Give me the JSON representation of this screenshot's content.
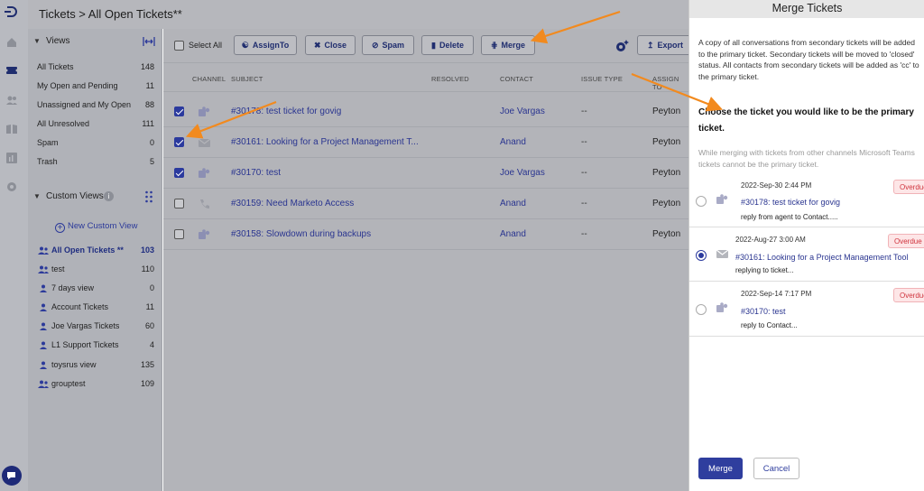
{
  "header": {
    "title": "Tickets > All Open Tickets**"
  },
  "rail": {
    "icons": [
      "logo-icon",
      "home-icon",
      "tickets-icon",
      "contacts-icon",
      "knowledge-base-icon",
      "reports-icon",
      "settings-icon",
      "chat-icon"
    ]
  },
  "views": {
    "title": "Views",
    "items": [
      {
        "label": "All Tickets",
        "count": "148"
      },
      {
        "label": "My Open and Pending",
        "count": "11"
      },
      {
        "label": "Unassigned and My Open",
        "count": "88"
      },
      {
        "label": "All Unresolved",
        "count": "111"
      },
      {
        "label": "Spam",
        "count": "0"
      },
      {
        "label": "Trash",
        "count": "5"
      }
    ]
  },
  "custom_views": {
    "title": "Custom Views",
    "new_label": "New Custom View",
    "items": [
      {
        "label": "All Open Tickets **",
        "count": "103",
        "icon": "group-icon",
        "active": true
      },
      {
        "label": "test",
        "count": "110",
        "icon": "group-icon"
      },
      {
        "label": "7 days view",
        "count": "0",
        "icon": "user-icon"
      },
      {
        "label": "Account Tickets",
        "count": "11",
        "icon": "user-icon"
      },
      {
        "label": "Joe Vargas Tickets",
        "count": "60",
        "icon": "user-icon"
      },
      {
        "label": "L1 Support Tickets",
        "count": "4",
        "icon": "user-icon"
      },
      {
        "label": "toysrus view",
        "count": "135",
        "icon": "user-icon"
      },
      {
        "label": "grouptest",
        "count": "109",
        "icon": "group-icon"
      }
    ]
  },
  "toolbar": {
    "select_all": "Select All",
    "assign": "AssignTo",
    "close": "Close",
    "spam": "Spam",
    "delete": "Delete",
    "merge": "Merge",
    "export": "Export"
  },
  "table": {
    "columns": [
      "CHANNEL",
      "SUBJECT",
      "RESOLVED",
      "CONTACT",
      "ISSUE TYPE",
      "ASSIGN TO"
    ],
    "rows": [
      {
        "checked": true,
        "channel": "teams",
        "subject": "#30178: test ticket for govig",
        "contact": "Joe Vargas",
        "issue": "--",
        "assign": "Peyton"
      },
      {
        "checked": true,
        "channel": "email",
        "subject": "#30161: Looking for a Project Management T...",
        "contact": "Anand",
        "issue": "--",
        "assign": "Peyton"
      },
      {
        "checked": true,
        "channel": "teams",
        "subject": "#30170: test",
        "contact": "Joe Vargas",
        "issue": "--",
        "assign": "Peyton"
      },
      {
        "checked": false,
        "channel": "phone",
        "subject": "#30159: Need Marketo Access",
        "contact": "Anand",
        "issue": "--",
        "assign": "Peyton"
      },
      {
        "checked": false,
        "channel": "teams",
        "subject": "#30158: Slowdown during backups",
        "contact": "Anand",
        "issue": "--",
        "assign": "Peyton"
      }
    ]
  },
  "merge_panel": {
    "title": "Merge Tickets",
    "description": "A copy of all conversations from secondary tickets will be added to the primary ticket. Secondary tickets will be moved to 'closed' status. All contacts from secondary tickets will be added as 'cc' to the primary ticket.",
    "heading": "Choose the ticket you would like to be the primary ticket.",
    "note": "While merging with tickets from other channels Microsoft Teams tickets cannot be the primary ticket.",
    "tickets": [
      {
        "date": "2022-Sep-30 2:44 PM",
        "title": "#30178: test ticket for govig",
        "snippet": "reply from agent to Contact.....",
        "badge": "Overdue",
        "selected": false,
        "channel": "teams"
      },
      {
        "date": "2022-Aug-27 3:00 AM",
        "title": "#30161: Looking for a Project Management Tool",
        "snippet": "replying to ticket...",
        "badge": "Overdue",
        "selected": true,
        "channel": "email"
      },
      {
        "date": "2022-Sep-14 7:17 PM",
        "title": "#30170: test",
        "snippet": "reply to Contact...",
        "badge": "Overdue",
        "selected": false,
        "channel": "teams"
      }
    ],
    "merge_label": "Merge",
    "cancel_label": "Cancel"
  },
  "colors": {
    "accent": "#2f3e9e",
    "overdue": "#d0343e",
    "annotation_arrow": "#f28a1e"
  }
}
